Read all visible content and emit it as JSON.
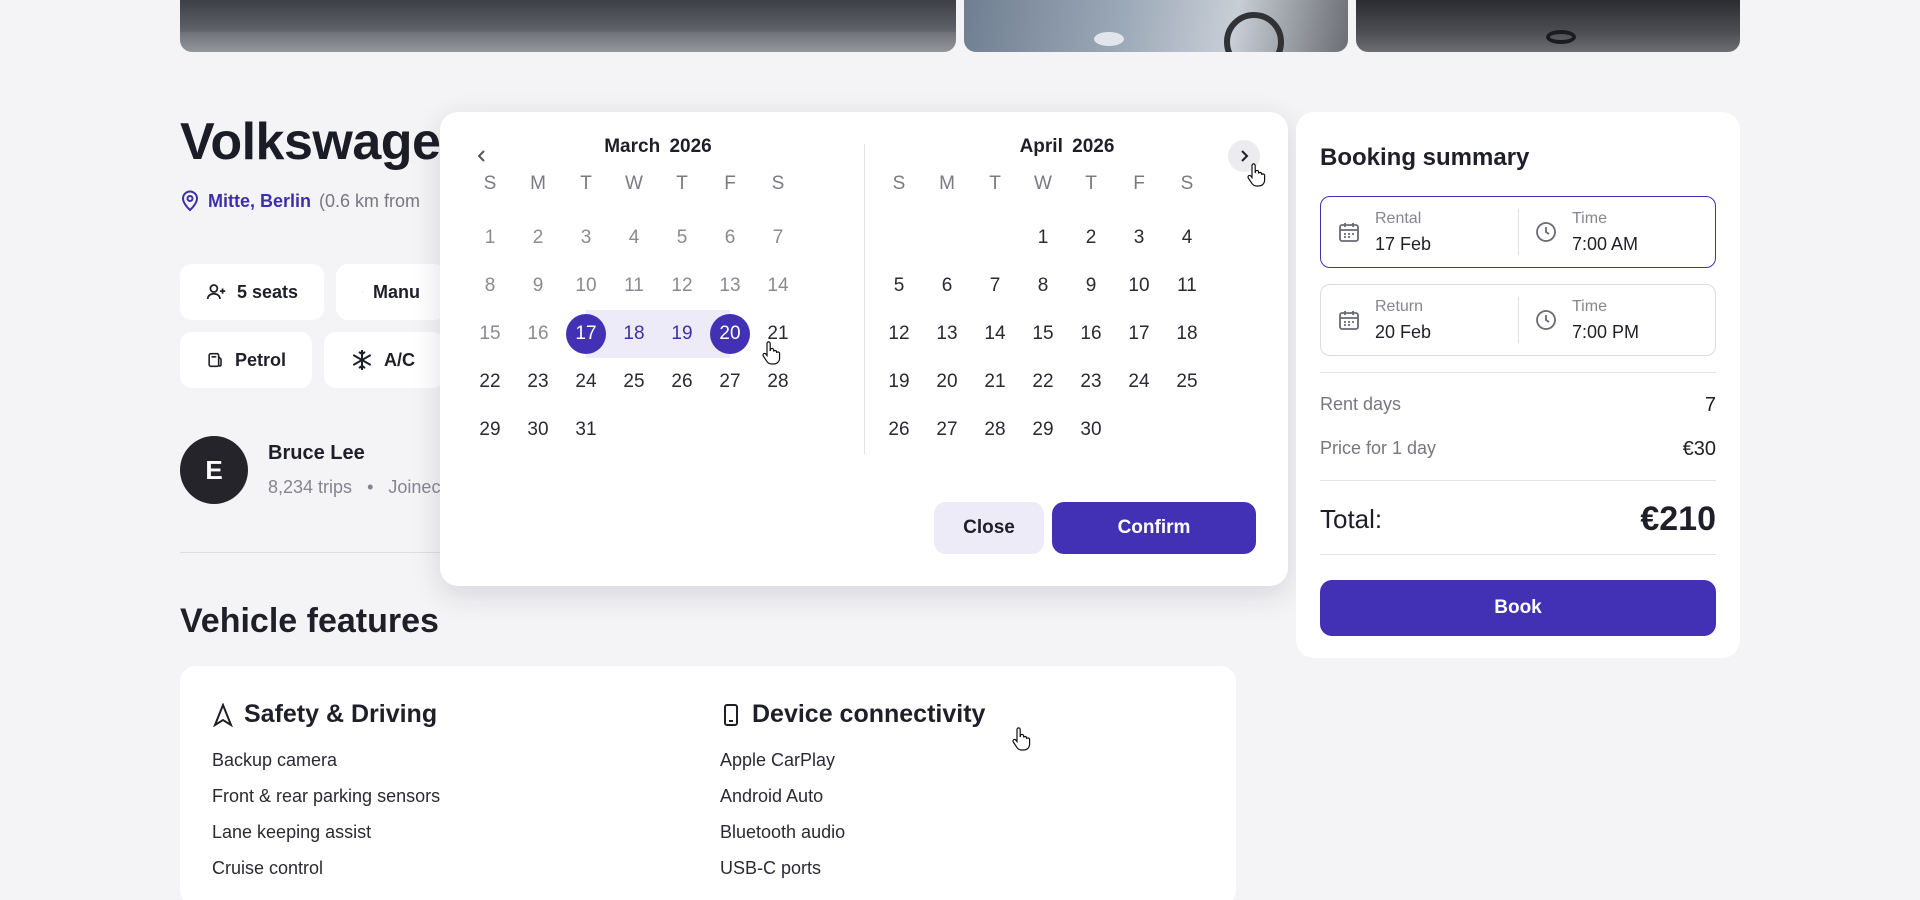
{
  "listing": {
    "title": "Volkswagen",
    "location_area": "Mitte, Berlin",
    "location_distance": "(0.6 km from"
  },
  "specs": {
    "seats": "5 seats",
    "transmission": "Manu",
    "fuel": "Petrol",
    "ac": "A/C"
  },
  "host": {
    "initial": "E",
    "name": "Bruce Lee",
    "trips": "8,234 trips",
    "separator": "•",
    "joined": "Joinec"
  },
  "features": {
    "title": "Vehicle features",
    "safety": {
      "title": "Safety & Driving",
      "items": [
        "Backup camera",
        "Front & rear parking sensors",
        "Lane keeping assist",
        "Cruise control"
      ]
    },
    "connectivity": {
      "title": "Device connectivity",
      "items": [
        "Apple CarPlay",
        "Android Auto",
        "Bluetooth audio",
        "USB-C ports"
      ]
    }
  },
  "calendar": {
    "weekdays": [
      "S",
      "M",
      "T",
      "W",
      "T",
      "F",
      "S"
    ],
    "months": [
      {
        "title": "March 2026",
        "offset": 0,
        "days": 31,
        "past_until": 16,
        "range_start": 17,
        "range_end": 20
      },
      {
        "title": "April 2026",
        "offset": 3,
        "days": 30,
        "past_until": 0,
        "range_start": 0,
        "range_end": 0
      }
    ],
    "close_label": "Close",
    "confirm_label": "Confirm"
  },
  "summary": {
    "title": "Booking summary",
    "rental": {
      "label": "Rental",
      "date": "17 Feb",
      "time_label": "Time",
      "time": "7:00 AM"
    },
    "return": {
      "label": "Return",
      "date": "20 Feb",
      "time_label": "Time",
      "time": "7:00 PM"
    },
    "rent_days_label": "Rent days",
    "rent_days": "7",
    "price_label": "Price for 1 day",
    "price": "€30",
    "total_label": "Total:",
    "total": "€210",
    "book_label": "Book"
  },
  "colors": {
    "accent": "#4331b5",
    "range": "#ecebf7",
    "link": "#3d2fa9"
  }
}
